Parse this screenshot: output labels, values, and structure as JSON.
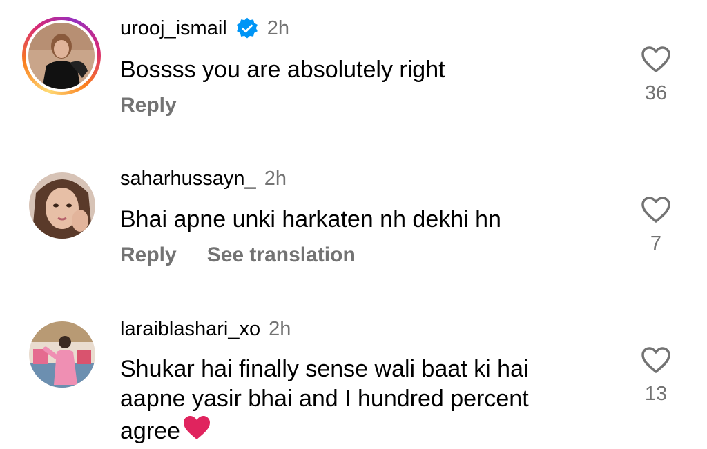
{
  "comments": [
    {
      "username": "urooj_ismail",
      "verified": true,
      "time": "2h",
      "text": "Bossss you are absolutely right",
      "actions": [
        "Reply"
      ],
      "likes": "36",
      "has_story_ring": true
    },
    {
      "username": "saharhussayn_",
      "verified": false,
      "time": "2h",
      "text": "Bhai apne unki harkaten nh dekhi hn",
      "actions": [
        "Reply",
        "See translation"
      ],
      "likes": "7",
      "has_story_ring": false
    },
    {
      "username": "laraiblashari_xo",
      "verified": false,
      "time": "2h",
      "text_lines": [
        "Shukar hai finally sense wali baat ki hai",
        "aapne yasir bhai and I hundred percent",
        "agree"
      ],
      "actions": [],
      "likes": "13",
      "has_story_ring": false
    }
  ],
  "colors": {
    "text": "#000000",
    "secondary": "#737373",
    "verified": "#0095f6",
    "heart_emoji": "#e0245e"
  },
  "icons": {
    "like": "heart-outline-icon",
    "verified": "verified-badge-icon",
    "emoji": "red-heart-emoji"
  }
}
